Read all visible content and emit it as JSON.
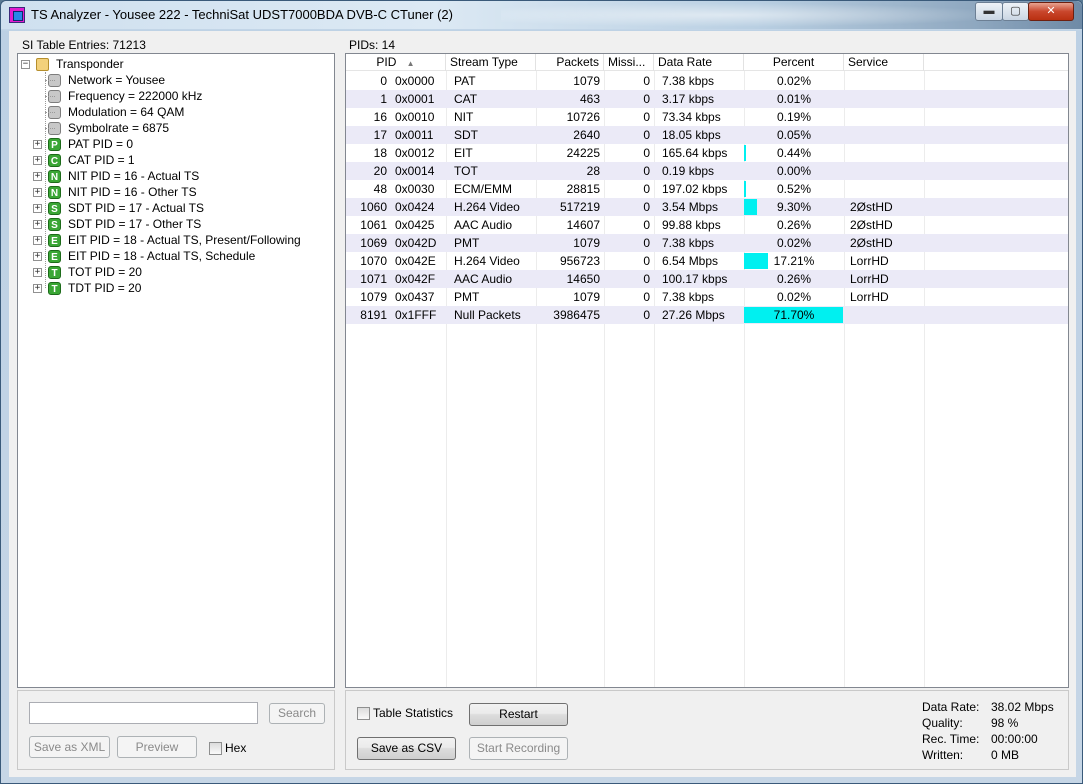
{
  "window": {
    "title": "TS Analyzer - Yousee 222 - TechniSat UDST7000BDA DVB-C CTuner (2)",
    "min_glyph": "▬",
    "max_glyph": "▢",
    "close_glyph": "✕"
  },
  "left_panel": {
    "header": "SI Table Entries: 71213",
    "tree": [
      {
        "label": "Transponder",
        "icon": "folder-icon",
        "level": 0,
        "expander": "−"
      },
      {
        "label": "Network = Yousee",
        "icon": "gray-node-icon",
        "level": 1,
        "expander": ""
      },
      {
        "label": "Frequency = 222000 kHz",
        "icon": "gray-node-icon",
        "level": 1,
        "expander": ""
      },
      {
        "label": "Modulation = 64 QAM",
        "icon": "gray-node-icon",
        "level": 1,
        "expander": ""
      },
      {
        "label": "Symbolrate = 6875",
        "icon": "gray-node-icon",
        "level": 1,
        "expander": ""
      },
      {
        "label": "PAT PID = 0",
        "icon": "P",
        "level": 1,
        "expander": "+"
      },
      {
        "label": "CAT PID = 1",
        "icon": "C",
        "level": 1,
        "expander": "+"
      },
      {
        "label": "NIT PID = 16 - Actual TS",
        "icon": "N",
        "level": 1,
        "expander": "+"
      },
      {
        "label": "NIT PID = 16 - Other TS",
        "icon": "N",
        "level": 1,
        "expander": "+"
      },
      {
        "label": "SDT PID = 17 - Actual TS",
        "icon": "S",
        "level": 1,
        "expander": "+"
      },
      {
        "label": "SDT PID = 17 - Other TS",
        "icon": "S",
        "level": 1,
        "expander": "+"
      },
      {
        "label": "EIT PID = 18 - Actual TS, Present/Following",
        "icon": "E",
        "level": 1,
        "expander": "+"
      },
      {
        "label": "EIT PID = 18 - Actual TS, Schedule",
        "icon": "E",
        "level": 1,
        "expander": "+"
      },
      {
        "label": "TOT PID = 20",
        "icon": "T",
        "level": 1,
        "expander": "+"
      },
      {
        "label": "TDT PID = 20",
        "icon": "T",
        "level": 1,
        "expander": "+"
      }
    ],
    "search_value": "",
    "search_label": "Search",
    "save_xml_label": "Save as XML",
    "preview_label": "Preview",
    "hex_label": "Hex"
  },
  "right_panel": {
    "header": "PIDs: 14",
    "columns": [
      "PID",
      "Stream Type",
      "Packets",
      "Missi...",
      "Data Rate",
      "Percent",
      "Service"
    ],
    "sort_glyph": "▲",
    "rows": [
      {
        "pid": "0",
        "hex": "0x0000",
        "type": "PAT",
        "packets": "1079",
        "missing": "0",
        "rate": "7.38 kbps",
        "percent": "0.02%",
        "pct": 0.02,
        "service": ""
      },
      {
        "pid": "1",
        "hex": "0x0001",
        "type": "CAT",
        "packets": "463",
        "missing": "0",
        "rate": "3.17 kbps",
        "percent": "0.01%",
        "pct": 0.01,
        "service": ""
      },
      {
        "pid": "16",
        "hex": "0x0010",
        "type": "NIT",
        "packets": "10726",
        "missing": "0",
        "rate": "73.34 kbps",
        "percent": "0.19%",
        "pct": 0.19,
        "service": ""
      },
      {
        "pid": "17",
        "hex": "0x0011",
        "type": "SDT",
        "packets": "2640",
        "missing": "0",
        "rate": "18.05 kbps",
        "percent": "0.05%",
        "pct": 0.05,
        "service": ""
      },
      {
        "pid": "18",
        "hex": "0x0012",
        "type": "EIT",
        "packets": "24225",
        "missing": "0",
        "rate": "165.64 kbps",
        "percent": "0.44%",
        "pct": 0.44,
        "service": ""
      },
      {
        "pid": "20",
        "hex": "0x0014",
        "type": "TOT",
        "packets": "28",
        "missing": "0",
        "rate": "0.19 kbps",
        "percent": "0.00%",
        "pct": 0.0,
        "service": ""
      },
      {
        "pid": "48",
        "hex": "0x0030",
        "type": "ECM/EMM",
        "packets": "28815",
        "missing": "0",
        "rate": "197.02 kbps",
        "percent": "0.52%",
        "pct": 0.52,
        "service": ""
      },
      {
        "pid": "1060",
        "hex": "0x0424",
        "type": "H.264 Video",
        "packets": "517219",
        "missing": "0",
        "rate": "3.54 Mbps",
        "percent": "9.30%",
        "pct": 9.3,
        "service": "2ØstHD"
      },
      {
        "pid": "1061",
        "hex": "0x0425",
        "type": "AAC Audio",
        "packets": "14607",
        "missing": "0",
        "rate": "99.88 kbps",
        "percent": "0.26%",
        "pct": 0.26,
        "service": "2ØstHD"
      },
      {
        "pid": "1069",
        "hex": "0x042D",
        "type": "PMT",
        "packets": "1079",
        "missing": "0",
        "rate": "7.38 kbps",
        "percent": "0.02%",
        "pct": 0.02,
        "service": "2ØstHD"
      },
      {
        "pid": "1070",
        "hex": "0x042E",
        "type": "H.264 Video",
        "packets": "956723",
        "missing": "0",
        "rate": "6.54 Mbps",
        "percent": "17.21%",
        "pct": 17.21,
        "service": "LorrHD"
      },
      {
        "pid": "1071",
        "hex": "0x042F",
        "type": "AAC Audio",
        "packets": "14650",
        "missing": "0",
        "rate": "100.17 kbps",
        "percent": "0.26%",
        "pct": 0.26,
        "service": "LorrHD"
      },
      {
        "pid": "1079",
        "hex": "0x0437",
        "type": "PMT",
        "packets": "1079",
        "missing": "0",
        "rate": "7.38 kbps",
        "percent": "0.02%",
        "pct": 0.02,
        "service": "LorrHD"
      },
      {
        "pid": "8191",
        "hex": "0x1FFF",
        "type": "Null Packets",
        "packets": "3986475",
        "missing": "0",
        "rate": "27.26 Mbps",
        "percent": "71.70%",
        "pct": 71.7,
        "service": ""
      }
    ],
    "bar_color": "#00f0f0",
    "table_statistics_label": "Table Statistics",
    "restart_label": "Restart",
    "save_csv_label": "Save as CSV",
    "start_recording_label": "Start Recording"
  },
  "status": {
    "data_rate_label": "Data Rate:",
    "data_rate_value": "38.02 Mbps",
    "quality_label": "Quality:",
    "quality_value": "98 %",
    "rec_time_label": "Rec. Time:",
    "rec_time_value": "00:00:00",
    "written_label": "Written:",
    "written_value": "0 MB"
  }
}
